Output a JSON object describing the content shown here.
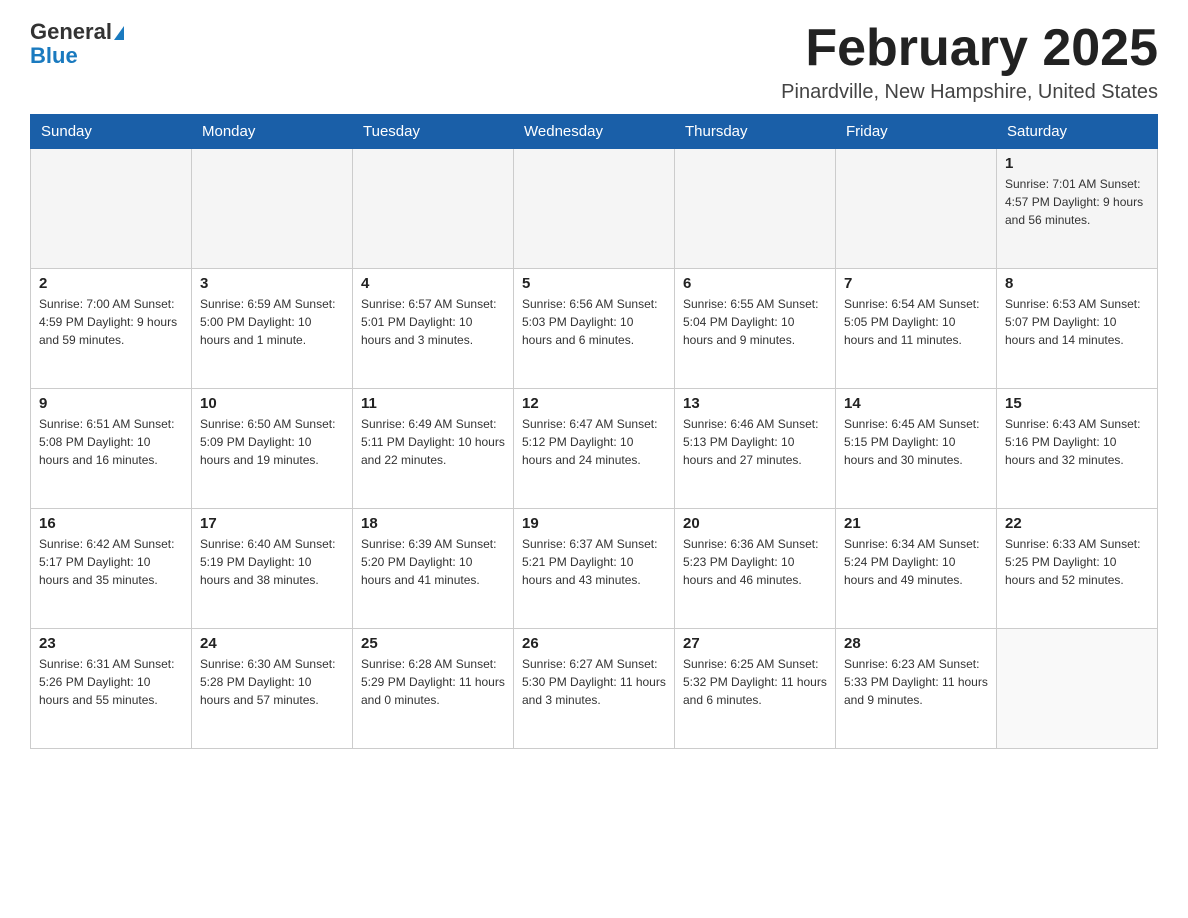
{
  "header": {
    "logo_general": "General",
    "logo_blue": "Blue",
    "month_title": "February 2025",
    "location": "Pinardville, New Hampshire, United States"
  },
  "days_of_week": [
    "Sunday",
    "Monday",
    "Tuesday",
    "Wednesday",
    "Thursday",
    "Friday",
    "Saturday"
  ],
  "weeks": [
    [
      {
        "day": "",
        "info": ""
      },
      {
        "day": "",
        "info": ""
      },
      {
        "day": "",
        "info": ""
      },
      {
        "day": "",
        "info": ""
      },
      {
        "day": "",
        "info": ""
      },
      {
        "day": "",
        "info": ""
      },
      {
        "day": "1",
        "info": "Sunrise: 7:01 AM\nSunset: 4:57 PM\nDaylight: 9 hours and 56 minutes."
      }
    ],
    [
      {
        "day": "2",
        "info": "Sunrise: 7:00 AM\nSunset: 4:59 PM\nDaylight: 9 hours and 59 minutes."
      },
      {
        "day": "3",
        "info": "Sunrise: 6:59 AM\nSunset: 5:00 PM\nDaylight: 10 hours and 1 minute."
      },
      {
        "day": "4",
        "info": "Sunrise: 6:57 AM\nSunset: 5:01 PM\nDaylight: 10 hours and 3 minutes."
      },
      {
        "day": "5",
        "info": "Sunrise: 6:56 AM\nSunset: 5:03 PM\nDaylight: 10 hours and 6 minutes."
      },
      {
        "day": "6",
        "info": "Sunrise: 6:55 AM\nSunset: 5:04 PM\nDaylight: 10 hours and 9 minutes."
      },
      {
        "day": "7",
        "info": "Sunrise: 6:54 AM\nSunset: 5:05 PM\nDaylight: 10 hours and 11 minutes."
      },
      {
        "day": "8",
        "info": "Sunrise: 6:53 AM\nSunset: 5:07 PM\nDaylight: 10 hours and 14 minutes."
      }
    ],
    [
      {
        "day": "9",
        "info": "Sunrise: 6:51 AM\nSunset: 5:08 PM\nDaylight: 10 hours and 16 minutes."
      },
      {
        "day": "10",
        "info": "Sunrise: 6:50 AM\nSunset: 5:09 PM\nDaylight: 10 hours and 19 minutes."
      },
      {
        "day": "11",
        "info": "Sunrise: 6:49 AM\nSunset: 5:11 PM\nDaylight: 10 hours and 22 minutes."
      },
      {
        "day": "12",
        "info": "Sunrise: 6:47 AM\nSunset: 5:12 PM\nDaylight: 10 hours and 24 minutes."
      },
      {
        "day": "13",
        "info": "Sunrise: 6:46 AM\nSunset: 5:13 PM\nDaylight: 10 hours and 27 minutes."
      },
      {
        "day": "14",
        "info": "Sunrise: 6:45 AM\nSunset: 5:15 PM\nDaylight: 10 hours and 30 minutes."
      },
      {
        "day": "15",
        "info": "Sunrise: 6:43 AM\nSunset: 5:16 PM\nDaylight: 10 hours and 32 minutes."
      }
    ],
    [
      {
        "day": "16",
        "info": "Sunrise: 6:42 AM\nSunset: 5:17 PM\nDaylight: 10 hours and 35 minutes."
      },
      {
        "day": "17",
        "info": "Sunrise: 6:40 AM\nSunset: 5:19 PM\nDaylight: 10 hours and 38 minutes."
      },
      {
        "day": "18",
        "info": "Sunrise: 6:39 AM\nSunset: 5:20 PM\nDaylight: 10 hours and 41 minutes."
      },
      {
        "day": "19",
        "info": "Sunrise: 6:37 AM\nSunset: 5:21 PM\nDaylight: 10 hours and 43 minutes."
      },
      {
        "day": "20",
        "info": "Sunrise: 6:36 AM\nSunset: 5:23 PM\nDaylight: 10 hours and 46 minutes."
      },
      {
        "day": "21",
        "info": "Sunrise: 6:34 AM\nSunset: 5:24 PM\nDaylight: 10 hours and 49 minutes."
      },
      {
        "day": "22",
        "info": "Sunrise: 6:33 AM\nSunset: 5:25 PM\nDaylight: 10 hours and 52 minutes."
      }
    ],
    [
      {
        "day": "23",
        "info": "Sunrise: 6:31 AM\nSunset: 5:26 PM\nDaylight: 10 hours and 55 minutes."
      },
      {
        "day": "24",
        "info": "Sunrise: 6:30 AM\nSunset: 5:28 PM\nDaylight: 10 hours and 57 minutes."
      },
      {
        "day": "25",
        "info": "Sunrise: 6:28 AM\nSunset: 5:29 PM\nDaylight: 11 hours and 0 minutes."
      },
      {
        "day": "26",
        "info": "Sunrise: 6:27 AM\nSunset: 5:30 PM\nDaylight: 11 hours and 3 minutes."
      },
      {
        "day": "27",
        "info": "Sunrise: 6:25 AM\nSunset: 5:32 PM\nDaylight: 11 hours and 6 minutes."
      },
      {
        "day": "28",
        "info": "Sunrise: 6:23 AM\nSunset: 5:33 PM\nDaylight: 11 hours and 9 minutes."
      },
      {
        "day": "",
        "info": ""
      }
    ]
  ]
}
